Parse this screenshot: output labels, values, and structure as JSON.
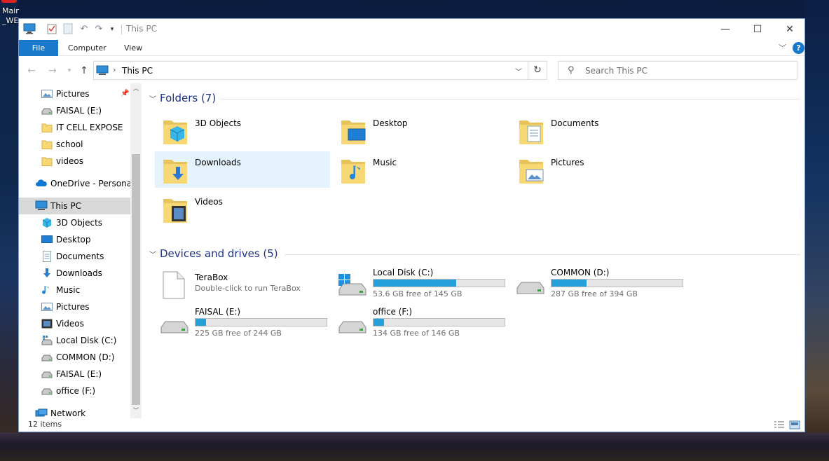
{
  "desktop": {
    "icon_label": "Main\n_WEP"
  },
  "window": {
    "title": "This PC",
    "controls": {
      "minimize": "—",
      "maximize": "☐",
      "close": "✕"
    }
  },
  "ribbon": {
    "tabs": [
      {
        "label": "File"
      },
      {
        "label": "Computer"
      },
      {
        "label": "View"
      }
    ],
    "help": "?"
  },
  "address": {
    "crumb": "This PC",
    "search_placeholder": "Search This PC"
  },
  "navpane": {
    "quick_access": [
      {
        "label": "Pictures",
        "icon": "pictures-icon",
        "pinned": true
      },
      {
        "label": "FAISAL  (E:)",
        "icon": "drive-icon"
      },
      {
        "label": "IT CELL EXPOSE",
        "icon": "folder-icon"
      },
      {
        "label": "school",
        "icon": "folder-icon"
      },
      {
        "label": "videos",
        "icon": "folder-icon"
      }
    ],
    "onedrive": "OneDrive - Personal",
    "this_pc": "This PC",
    "this_pc_items": [
      {
        "label": "3D Objects",
        "icon": "3d-objects-icon"
      },
      {
        "label": "Desktop",
        "icon": "desktop-icon"
      },
      {
        "label": "Documents",
        "icon": "documents-icon"
      },
      {
        "label": "Downloads",
        "icon": "downloads-icon"
      },
      {
        "label": "Music",
        "icon": "music-icon"
      },
      {
        "label": "Pictures",
        "icon": "pictures-icon"
      },
      {
        "label": "Videos",
        "icon": "videos-icon"
      },
      {
        "label": "Local Disk (C:)",
        "icon": "windows-drive-icon"
      },
      {
        "label": "COMMON  (D:)",
        "icon": "drive-icon"
      },
      {
        "label": "FAISAL  (E:)",
        "icon": "drive-icon"
      },
      {
        "label": "office  (F:)",
        "icon": "drive-icon"
      }
    ],
    "network": "Network"
  },
  "content": {
    "folders_header": "Folders (7)",
    "folders": [
      {
        "label": "3D Objects",
        "icon": "3d-objects-folder-icon"
      },
      {
        "label": "Desktop",
        "icon": "desktop-folder-icon"
      },
      {
        "label": "Documents",
        "icon": "documents-folder-icon"
      },
      {
        "label": "Downloads",
        "icon": "downloads-folder-icon"
      },
      {
        "label": "Music",
        "icon": "music-folder-icon"
      },
      {
        "label": "Pictures",
        "icon": "pictures-folder-icon"
      },
      {
        "label": "Videos",
        "icon": "videos-folder-icon"
      }
    ],
    "drives_header": "Devices and drives (5)",
    "terabox": {
      "name": "TeraBox",
      "subtitle": "Double-click to run TeraBox"
    },
    "drives": [
      {
        "name": "Local Disk (C:)",
        "free": "53.6 GB free of 145 GB",
        "used_fraction": 0.63,
        "icon": "windows-drive-icon"
      },
      {
        "name": "COMMON  (D:)",
        "free": "287 GB free of 394 GB",
        "used_fraction": 0.27,
        "icon": "drive-icon"
      },
      {
        "name": "FAISAL  (E:)",
        "free": "225 GB free of 244 GB",
        "used_fraction": 0.08,
        "icon": "drive-icon"
      },
      {
        "name": "office  (F:)",
        "free": "134 GB free of 146 GB",
        "used_fraction": 0.08,
        "icon": "drive-icon"
      }
    ]
  },
  "status": {
    "item_count": "12 items"
  },
  "colors": {
    "accent": "#1979ca",
    "header_blue": "#1e3287",
    "drive_fill": "#26a0da",
    "hover": "#e5f3ff"
  }
}
